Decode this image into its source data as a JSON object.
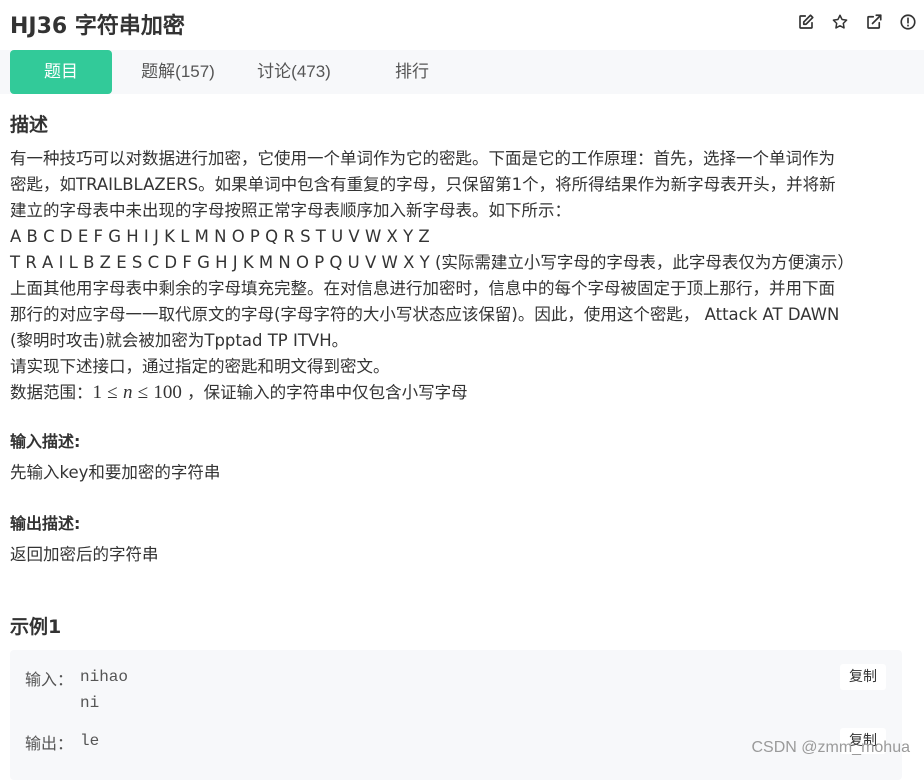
{
  "problem": {
    "title": "HJ36  字符串加密"
  },
  "header_icons": [
    "edit-icon",
    "star-icon",
    "external-link-icon",
    "info-icon"
  ],
  "tabs": [
    {
      "label": "题目",
      "active": true
    },
    {
      "label": "题解(157)",
      "active": false
    },
    {
      "label": "讨论(473)",
      "active": false
    },
    {
      "label": "排行",
      "active": false
    }
  ],
  "description": {
    "heading": "描述",
    "lines": [
      "有一种技巧可以对数据进行加密，它使用一个单词作为它的密匙。下面是它的工作原理：首先，选择一个单词作为",
      "密匙，如TRAILBLAZERS。如果单词中包含有重复的字母，只保留第1个，将所得结果作为新字母表开头，并将新",
      "建立的字母表中未出现的字母按照正常字母表顺序加入新字母表。如下所示：",
      "A B C D E F G H I J K L M N O P Q R S T U V W X Y Z",
      "T R A I L B Z E S C D F G H J K M N O P Q U V W X Y (实际需建立小写字母的字母表，此字母表仅为方便演示）",
      "上面其他用字母表中剩余的字母填充完整。在对信息进行加密时，信息中的每个字母被固定于顶上那行，并用下面",
      "那行的对应字母一一取代原文的字母(字母字符的大小写状态应该保留)。因此，使用这个密匙， Attack AT DAWN",
      "(黎明时攻击)就会被加密为Tpptad TP ITVH。",
      "请实现下述接口，通过指定的密匙和明文得到密文。"
    ],
    "range_prefix": "数据范围：",
    "range_math_1": "1",
    "range_math_le1": "≤",
    "range_math_n": "n",
    "range_math_le2": "≤",
    "range_math_100": "100",
    "range_suffix": " ，保证输入的字符串中仅包含小写字母"
  },
  "input_desc": {
    "heading": "输入描述:",
    "text": "先输入key和要加密的字符串"
  },
  "output_desc": {
    "heading": "输出描述:",
    "text": "返回加密后的字符串"
  },
  "example": {
    "heading": "示例1",
    "input_label": "输入：",
    "input_lines": [
      "nihao",
      "ni"
    ],
    "output_label": "输出：",
    "output_value": "le",
    "copy_label": "复制"
  },
  "watermark": "CSDN @zmm_mohua"
}
